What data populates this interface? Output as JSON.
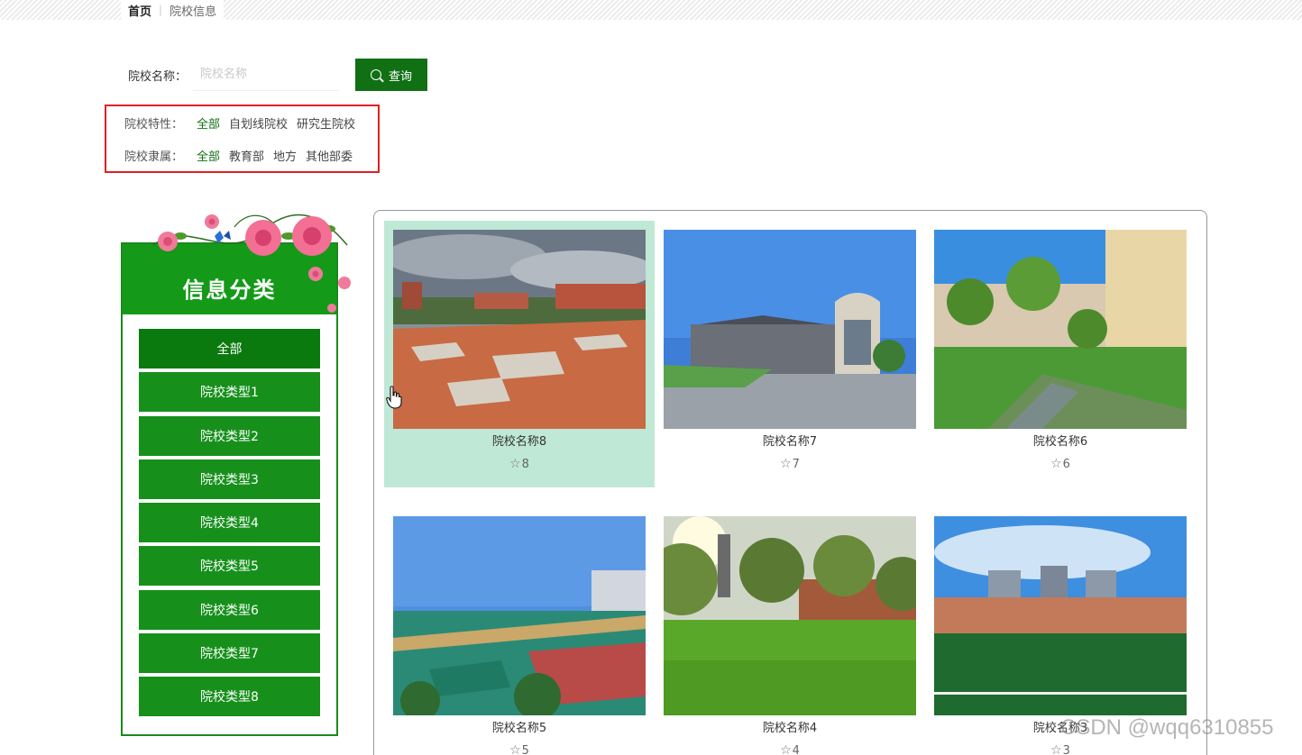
{
  "breadcrumb": {
    "home": "首页",
    "separator": "|",
    "current": "院校信息"
  },
  "search": {
    "label": "院校名称：",
    "placeholder": "院校名称",
    "value": "",
    "button_label": "查询"
  },
  "filters": {
    "nature": {
      "label": "院校特性：",
      "options": [
        "全部",
        "自划线院校",
        "研究生院校"
      ],
      "active": 0
    },
    "affiliation": {
      "label": "院校隶属：",
      "options": [
        "全部",
        "教育部",
        "地方",
        "其他部委"
      ],
      "active": 0
    }
  },
  "sidebar": {
    "title": "信息分类",
    "items": [
      "全部",
      "院校类型1",
      "院校类型2",
      "院校类型3",
      "院校类型4",
      "院校类型5",
      "院校类型6",
      "院校类型7",
      "院校类型8"
    ]
  },
  "schools": [
    {
      "name": "院校名称8",
      "likes": "8"
    },
    {
      "name": "院校名称7",
      "likes": "7"
    },
    {
      "name": "院校名称6",
      "likes": "6"
    },
    {
      "name": "院校名称5",
      "likes": "5"
    },
    {
      "name": "院校名称4",
      "likes": "4"
    },
    {
      "name": "院校名称3",
      "likes": "3"
    }
  ],
  "watermark": "CSDN @wqq6310855",
  "colors": {
    "primary_green": "#116f14",
    "sidebar_green": "#16901b",
    "hover_card": "#bfe9d6",
    "highlight_border": "#e02020"
  }
}
